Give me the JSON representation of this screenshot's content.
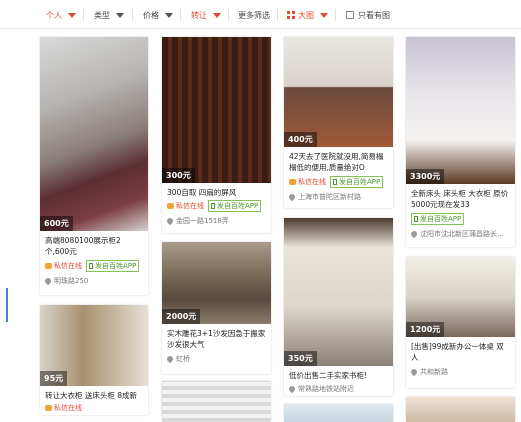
{
  "filters": {
    "personal": "个人",
    "type": "类型",
    "price": "价格",
    "transfer": "转让",
    "more": "更多筛选",
    "bigview": "大图",
    "only_images": "只看有图"
  },
  "cards": [
    {
      "price": "600元",
      "title": "高端8080100展示柜2个,600元",
      "chat": "私信在线",
      "app": "发自百姓APP",
      "location": "明珠路250"
    },
    {
      "price": "300元",
      "title": "300自取 四扇的屏风",
      "chat": "私信在线",
      "app": "发自百姓APP",
      "location": "金园一路1518弄"
    },
    {
      "price": "400元",
      "title": "42天去了医院就没用,简易榻榻低的便用,质量绝对O",
      "chat": "私信在线",
      "app": "发自百姓APP",
      "location": "上海市普陀区新村路"
    },
    {
      "price": "3300元",
      "title": "全新床头 床头柜 大衣柜 原价5000元现在发33",
      "app": "发自百姓APP",
      "location": "沈阳市沈北新区蒲昌路长..."
    },
    {
      "price": "2000元",
      "title": "实木雕花3+1沙发因急于搬家沙发很大气",
      "location": "虹桥"
    },
    {
      "price": "350元",
      "title": "低价出售二手实家书柜!",
      "location": "常熟路地铁站附近"
    },
    {
      "price": "1200元",
      "title": "[出售]99成新办公一体桌 双人",
      "location": "共和新路"
    },
    {
      "price": "95元",
      "title": "转让大衣柜 送床头柜 8成新",
      "chat": "私信在线"
    }
  ]
}
